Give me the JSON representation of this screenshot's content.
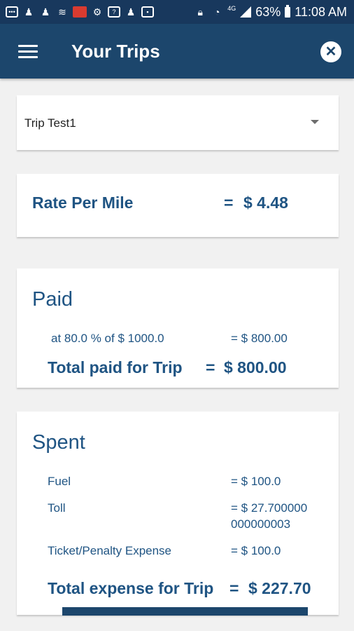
{
  "status_bar": {
    "battery_percent": "63%",
    "time": "11:08 AM",
    "network": "4G",
    "icons": [
      "message-icon",
      "person-icon",
      "person-icon",
      "wifi-icon",
      "app-icon",
      "settings-icon",
      "bluetooth-icon",
      "person-icon",
      "image-icon",
      "lock-icon",
      "wifi-icon",
      "signal-icon",
      "battery-icon"
    ]
  },
  "app_bar": {
    "title": "Your Trips",
    "menu_icon": "menu-icon",
    "close_icon": "close-icon",
    "close_symbol": "✕"
  },
  "trip_selector": {
    "selected": "Trip Test1"
  },
  "rate": {
    "label": "Rate Per Mile",
    "equals": "=",
    "value": "$ 4.48"
  },
  "paid": {
    "title": "Paid",
    "detail_left": "at 80.0 % of  $ 1000.0",
    "detail_right": "=  $ 800.00",
    "total_label": "Total paid for Trip",
    "total_equals": "=",
    "total_value": "$ 800.00"
  },
  "spent": {
    "title": "Spent",
    "items": [
      {
        "label": "Fuel",
        "value": "=  $ 100.0"
      },
      {
        "label": "Toll",
        "value": "=  $ 27.700000",
        "value_cont": "000000003"
      },
      {
        "label": "Ticket/Penalty Expense",
        "value": "=  $ 100.0"
      }
    ],
    "total_label": "Total expense for Trip",
    "total_equals": "=",
    "total_value": "$ 227.70"
  },
  "colors": {
    "primary": "#1c466c",
    "text_blue": "#1f5483",
    "background": "#f1f1f1"
  }
}
